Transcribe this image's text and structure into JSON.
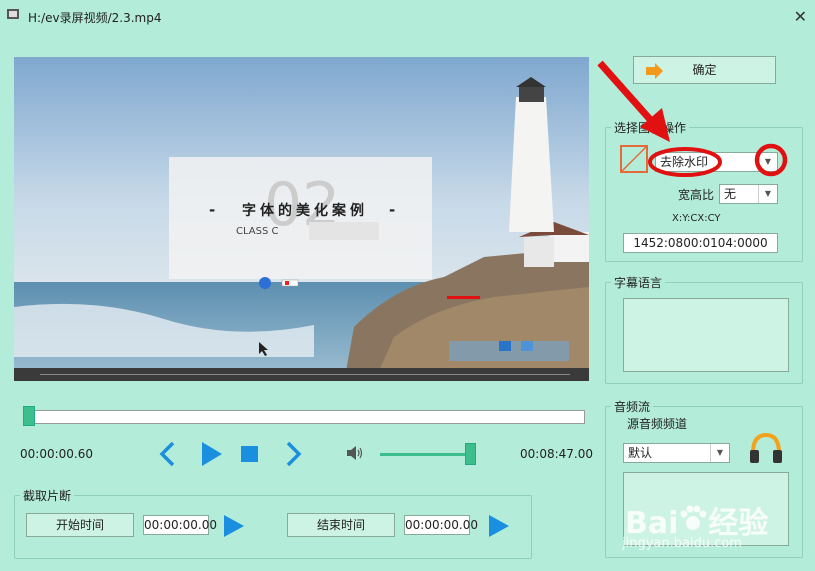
{
  "window": {
    "title": "H:/ev录屏视频/2.3.mp4"
  },
  "video_frame": {
    "slide_title": "字体的美化案例",
    "slide_subtitle": "CLASS C",
    "slide_number": "02"
  },
  "player": {
    "current_time": "00:00:00.60",
    "total_time": "00:08:47.00",
    "seek_progress": 0.0
  },
  "clip": {
    "group_label": "截取片断",
    "start_button": "开始时间",
    "start_value": "00:00:00.00",
    "end_button": "结束时间",
    "end_value": "00:00:00.00"
  },
  "right_panel": {
    "confirm_button": "确定",
    "image_op": {
      "group_label": "选择图像操作",
      "operation_selected": "去除水印",
      "aspect_label": "宽高比",
      "aspect_selected": "无",
      "coord_label": "X:Y:CX:CY",
      "coord_value": "1452:0800:0104:0000"
    },
    "subtitle": {
      "group_label": "字幕语言"
    },
    "audio": {
      "group_label": "音频流",
      "channel_label": "源音频频道",
      "channel_selected": "默认"
    }
  },
  "watermark": {
    "brand": "Bai",
    "brand2": "经验",
    "url": "jingyan.baidu.com"
  },
  "colors": {
    "background": "#b3ecd8",
    "accent": "#1a8fe0",
    "annotation": "#e21111"
  }
}
